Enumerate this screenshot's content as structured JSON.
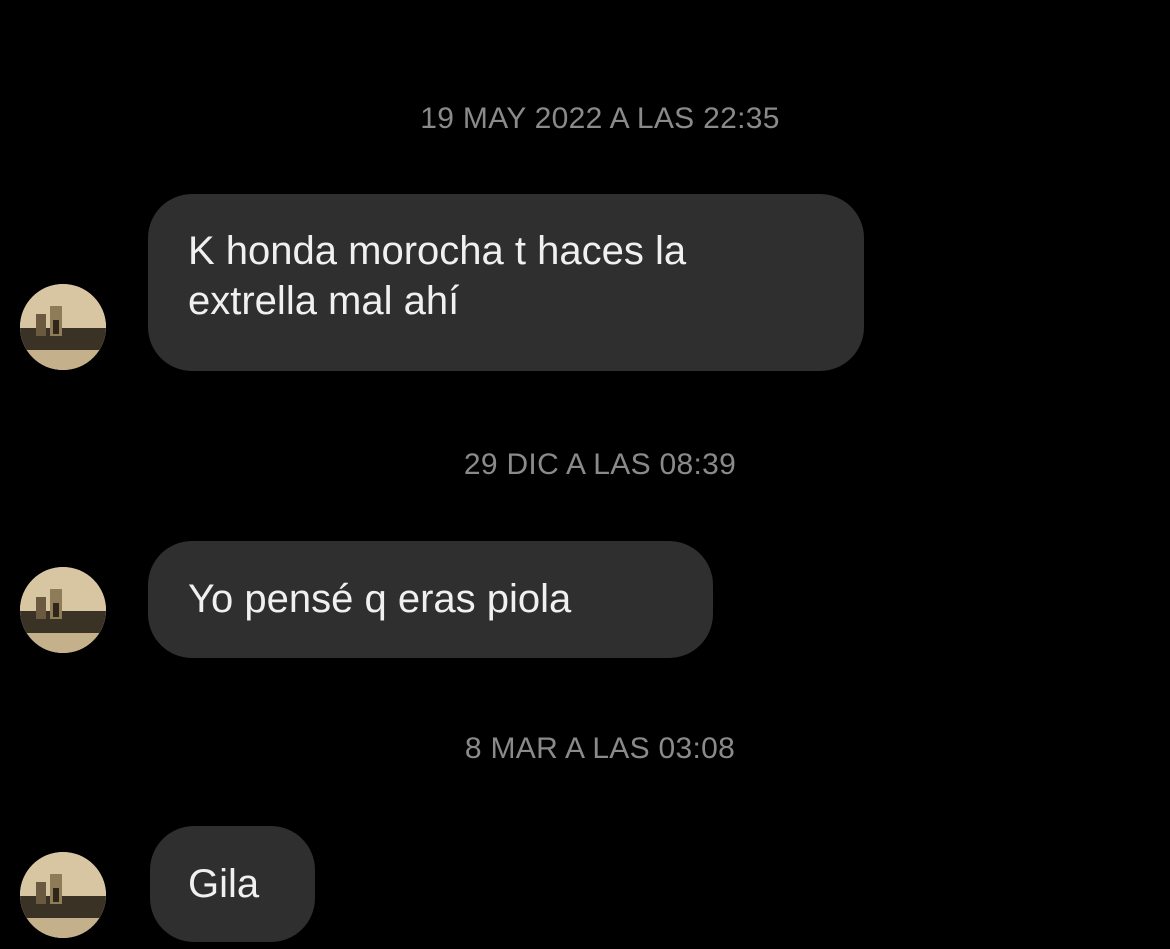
{
  "colors": {
    "background": "#000000",
    "bubble": "#2f2f2f",
    "bubble_text": "#f0f0f0",
    "timestamp_text": "#8a8a8a"
  },
  "conversation": {
    "groups": [
      {
        "timestamp": "19 MAY 2022 A LAS 22:35",
        "message_lines": [
          "K honda morocha t haces la",
          "extrella mal ahí"
        ]
      },
      {
        "timestamp": "29 DIC A LAS 08:39",
        "message_lines": [
          "Yo pensé q eras piola"
        ]
      },
      {
        "timestamp": "8 MAR A LAS 03:08",
        "message_lines": [
          "Gila"
        ]
      }
    ],
    "sender_avatar_icon": "contact-avatar-photo"
  }
}
